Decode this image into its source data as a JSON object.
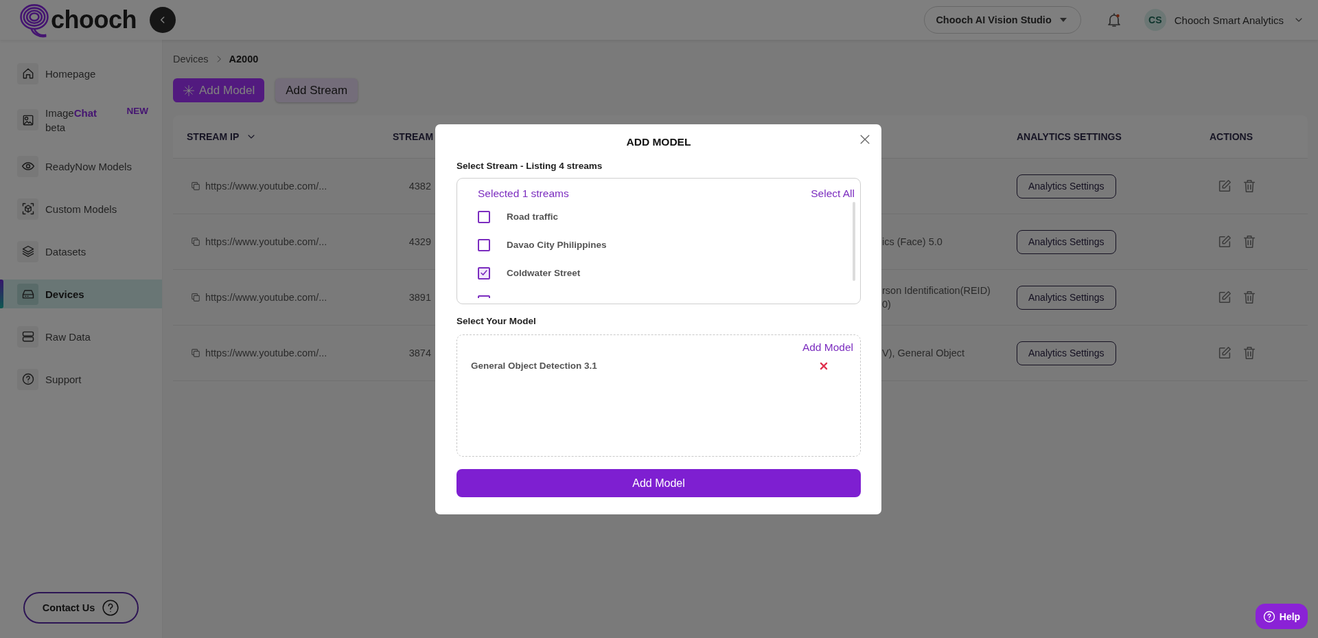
{
  "header": {
    "logo": "chooch",
    "workspace": "Chooch AI Vision Studio",
    "avatar_initials": "CS",
    "account": "Chooch Smart Analytics"
  },
  "sidebar": {
    "items": [
      {
        "label": "Homepage",
        "selected": false
      },
      {
        "label": "Image**Chat**",
        "sublabel": "beta",
        "badge": "NEW",
        "selected": false
      },
      {
        "label": "ReadyNow Models",
        "selected": false
      },
      {
        "label": "Custom Models",
        "selected": false
      },
      {
        "label": "Datasets",
        "selected": false
      },
      {
        "label": "Devices",
        "selected": true
      },
      {
        "label": "Raw Data",
        "selected": false
      },
      {
        "label": "Support",
        "selected": false
      }
    ],
    "contact": "Contact Us"
  },
  "breadcrumb": [
    "Devices",
    "A2000"
  ],
  "actions": [
    {
      "label": "Add Model",
      "kind": "primary"
    },
    {
      "label": "Add Stream",
      "kind": "secondary"
    }
  ],
  "table": {
    "columns": [
      {
        "label": "STREAM IP"
      },
      {
        "label": "STREAM"
      },
      {
        "label": "ANALYTICS SETTINGS"
      },
      {
        "label": "ACTIONS"
      }
    ],
    "rows": [
      {
        "stream_ip": "https://www.youtube.com/...",
        "stream": "4382",
        "model_lines": [],
        "analytics": "Analytics Settings"
      },
      {
        "stream_ip": "https://www.youtube.com/...",
        "stream": "4329",
        "model_lines": [
          "ics (Face) 5.0"
        ],
        "analytics": "Analytics Settings"
      },
      {
        "stream_ip": "https://www.youtube.com/...",
        "stream": "3891",
        "model_lines": [
          "rson Identification(REID)",
          "0)"
        ],
        "analytics": "Analytics Settings"
      },
      {
        "stream_ip": "https://www.youtube.com/...",
        "stream": "3874",
        "model_lines": [
          "V), General Object"
        ],
        "analytics": "Analytics Settings"
      }
    ]
  },
  "modal": {
    "title": "ADD MODEL",
    "stream_label": "Select Stream - Listing 4 streams",
    "selected_count": "Selected 1 streams",
    "select_all": "Select All",
    "streams": [
      {
        "label": "Road traffic",
        "checked": false
      },
      {
        "label": "Davao City Philippines",
        "checked": false
      },
      {
        "label": "Coldwater Street",
        "checked": true
      },
      {
        "checked": false
      }
    ],
    "model_label": "Select Your Model",
    "add_model_link": "Add Model",
    "models": [
      {
        "name": "General Object Detection 3.1"
      }
    ],
    "submit": "Add Model"
  },
  "help": "Help"
}
